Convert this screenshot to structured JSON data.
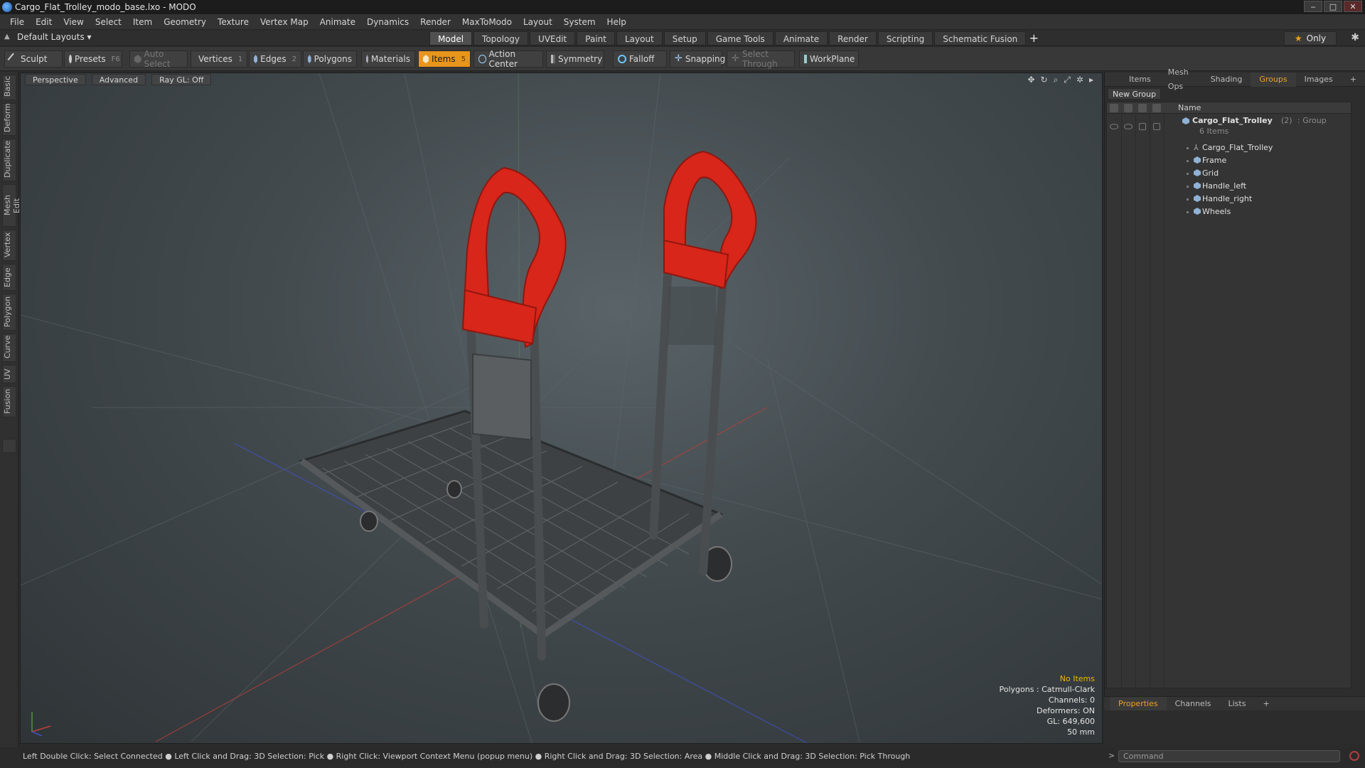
{
  "window": {
    "title": "Cargo_Flat_Trolley_modo_base.lxo - MODO",
    "minimize": "‒",
    "maximize": "□",
    "close": "✕"
  },
  "menu": [
    "File",
    "Edit",
    "View",
    "Select",
    "Item",
    "Geometry",
    "Texture",
    "Vertex Map",
    "Animate",
    "Dynamics",
    "Render",
    "MaxToModo",
    "Layout",
    "System",
    "Help"
  ],
  "layouts": {
    "dropdown": "Default Layouts ▾",
    "tabs": [
      "Model",
      "Topology",
      "UVEdit",
      "Paint",
      "Layout",
      "Setup",
      "Game Tools",
      "Animate",
      "Render",
      "Scripting",
      "Schematic Fusion"
    ],
    "active": "Model",
    "add": "+",
    "only": "Only"
  },
  "toolbar": {
    "sculpt": "Sculpt",
    "presets": "Presets",
    "presets_key": "F6",
    "auto_select": "Auto Select",
    "vertices": "Vertices",
    "vertices_key": "1",
    "edges": "Edges",
    "edges_key": "2",
    "polygons": "Polygons",
    "materials": "Materials",
    "items": "Items",
    "items_key": "5",
    "action_center": "Action Center",
    "symmetry": "Symmetry",
    "falloff": "Falloff",
    "snapping": "Snapping",
    "select_through": "Select Through",
    "workplane": "WorkPlane"
  },
  "side_tabs": [
    "Basic",
    "Deform",
    "Duplicate",
    "Mesh Edit",
    "Vertex",
    "Edge",
    "Polygon",
    "Curve",
    "UV",
    "Fusion"
  ],
  "viewport": {
    "view": "Perspective",
    "shading": "Advanced",
    "raygl": "Ray GL: Off",
    "info": {
      "no_items": "No Items",
      "polygons": "Polygons : Catmull-Clark",
      "channels": "Channels: 0",
      "deformers": "Deformers: ON",
      "gl": "GL: 649,600",
      "scale": "50 mm"
    }
  },
  "right_panel": {
    "tabs": [
      "Items",
      "Mesh Ops",
      "Shading",
      "Groups",
      "Images"
    ],
    "active": "Groups",
    "add": "+",
    "new_group": "New Group",
    "column_name": "Name",
    "group": {
      "name": "Cargo_Flat_Trolley",
      "count": "(2)",
      "type": ": Group",
      "items": "6 Items"
    },
    "children": [
      "Cargo_Flat_Trolley",
      "Frame",
      "Grid",
      "Handle_left",
      "Handle_right",
      "Wheels"
    ]
  },
  "props_tabs": [
    "Properties",
    "Channels",
    "Lists"
  ],
  "props_active": "Properties",
  "props_add": "+",
  "status": "Left Double Click: Select Connected ● Left Click and Drag: 3D Selection: Pick ● Right Click: Viewport Context Menu (popup menu) ● Right Click and Drag: 3D Selection: Area ● Middle Click and Drag: 3D Selection: Pick Through",
  "command": {
    "placeholder": "Command",
    "arrow": ">"
  },
  "colors": {
    "accent": "#e8951c",
    "handle": "#d8261a",
    "frame": "#4a4d50"
  }
}
